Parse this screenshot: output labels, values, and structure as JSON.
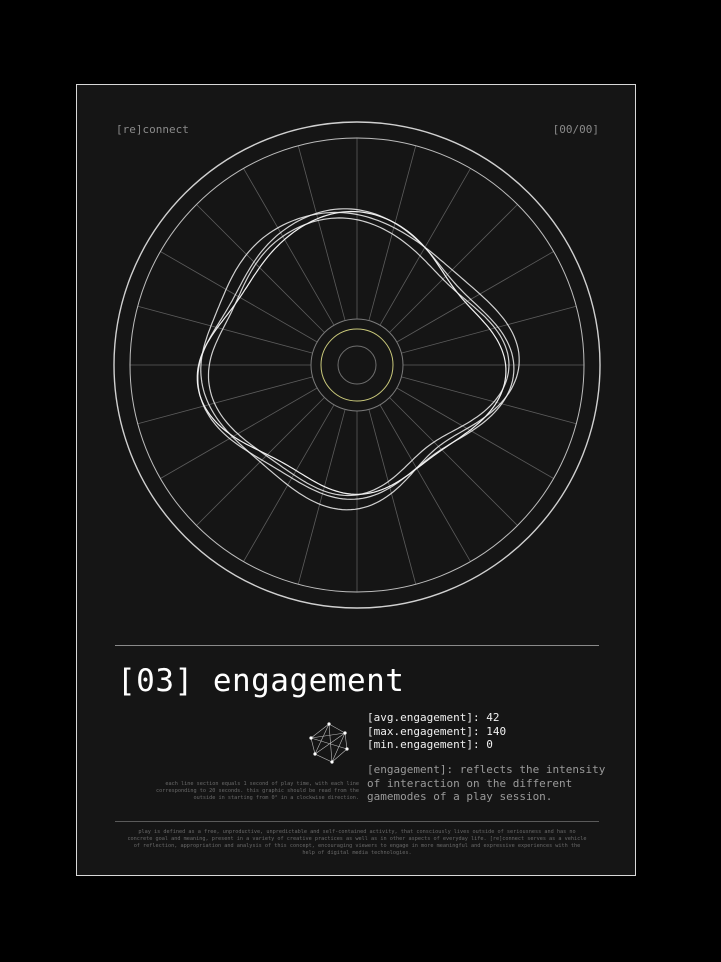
{
  "header": {
    "brand": "[re]connect",
    "page": "[00/00]"
  },
  "title": "[03] engagement",
  "stats": {
    "avg": "[avg.engagement]: 42",
    "max": "[max.engagement]: 140",
    "min": "[min.engagement]: 0"
  },
  "description": {
    "keyword": "[engagement]",
    "text": ": reflects the intensity of interaction on the different gamemodes of a play session."
  },
  "howto": "each line section equals 1 second of play time, with each line corresponding to 20 seconds. this graphic should be read from the outside in starting from 0° in a clockwise direction.",
  "footer": "play is defined as a free, unproductive, unpredictable and self-contained activity, that consciously lives outside of seriousness and has no concrete goal and meaning, present in a variety of creative practices as well as in other aspects of everyday life. [re]connect serves as a vehicle of reflection, appropriation and analysis of this concept, encouraging viewers to engage in more meaningful and expressive experiences with the help of digital media technologies.",
  "colors": {
    "background": "#151515",
    "line": "#ffffff",
    "accent": "#c9c87a"
  },
  "icons": {
    "graph": "node-graph-icon"
  }
}
